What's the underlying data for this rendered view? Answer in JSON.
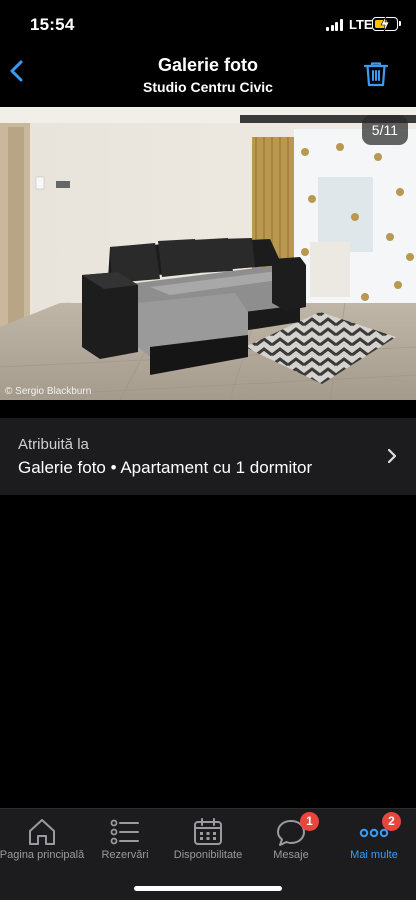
{
  "status_bar": {
    "time": "15:54",
    "network": "LTE"
  },
  "header": {
    "title": "Galerie foto",
    "subtitle": "Studio Centru Civic",
    "back_icon": "chevron-left-icon",
    "trash_icon": "trash-icon"
  },
  "photo": {
    "counter": "5/11",
    "copyright": "© Sergio Blackburn"
  },
  "attribution": {
    "label": "Atribuită la",
    "value": "Galerie foto • Apartament cu 1 dormitor"
  },
  "tabbar": {
    "accent_color": "#3b9cf5",
    "inactive_color": "#9a9aa0",
    "badge_color": "#e8453c",
    "tabs": [
      {
        "label": "Pagina principală",
        "icon": "home-icon"
      },
      {
        "label": "Rezervări",
        "icon": "list-icon"
      },
      {
        "label": "Disponibilitate",
        "icon": "calendar-icon"
      },
      {
        "label": "Mesaje",
        "icon": "chat-bubble-icon",
        "badge": "1"
      },
      {
        "label": "Mai multe",
        "icon": "more-dots-icon",
        "badge": "2"
      }
    ]
  }
}
